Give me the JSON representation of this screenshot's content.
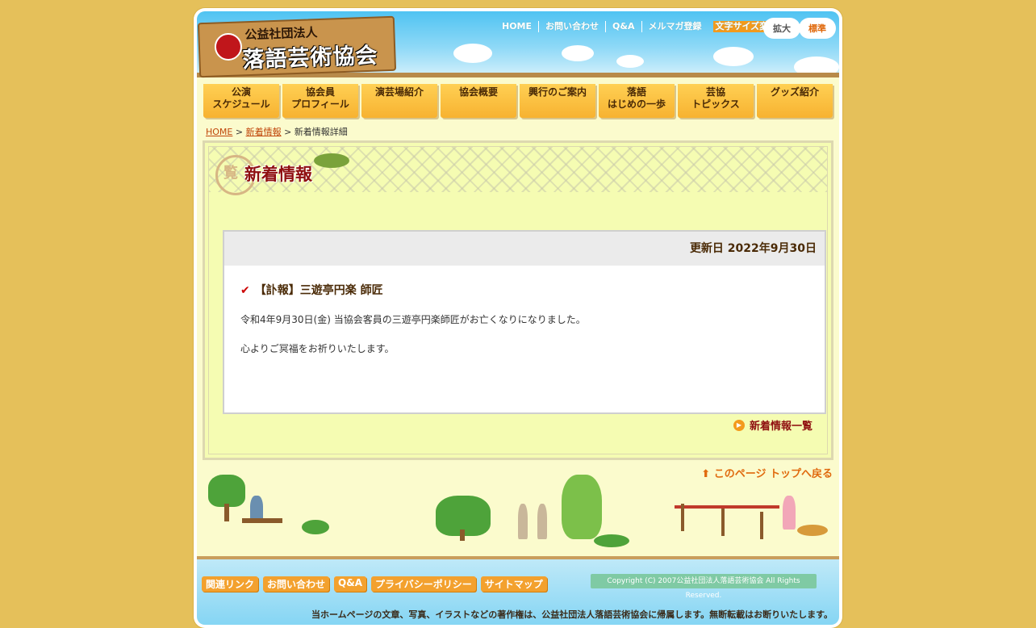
{
  "header": {
    "logo_small": "公益社団法人",
    "logo_big": "落語芸術協会",
    "top_links": [
      "HOME",
      "お問い合わせ",
      "Q&A",
      "メルマガ登録"
    ],
    "font_size_label": "文字サイズ変更",
    "enlarge_label": "拡大",
    "standard_label": "標準"
  },
  "nav": [
    "公演\nスケジュール",
    "協会員\nプロフィール",
    "演芸場紹介",
    "協会概要",
    "興行のご案内",
    "落語\nはじめの一歩",
    "芸協\nトピックス",
    "グッズ紹介"
  ],
  "breadcrumb": {
    "home": "HOME",
    "sep1": " > ",
    "news": "新着情報",
    "sep2": " > ",
    "current": "新着情報詳細"
  },
  "section": {
    "title": "新着情報",
    "badge": "覧"
  },
  "article": {
    "updated": "更新日 2022年9月30日",
    "title": "【訃報】三遊亭円楽 師匠",
    "body1": "令和4年9月30日(金) 当協会客員の三遊亭円楽師匠がお亡くなりになりました。",
    "body2": "心よりご冥福をお祈りいたします。"
  },
  "list_link": "新着情報一覧",
  "back_to_top": "このページ トップへ戻る",
  "footer": {
    "links": [
      "関連リンク",
      "お問い合わせ",
      "Q&A",
      "プライバシーポリシー",
      "サイトマップ"
    ],
    "copyright": "Copyright (C) 2007公益社団法人落語芸術協会 All Rights Reserved.",
    "notice": "当ホームページの文章、写真、イラストなどの著作権は、公益社団法人落語芸術協会に帰属します。無断転載はお断りいたします。"
  },
  "colors": {
    "page_bg": "#e5c05a",
    "content_bg": "#f5fcb2",
    "accent": "#f39a1c",
    "title_red": "#8f0f10"
  }
}
